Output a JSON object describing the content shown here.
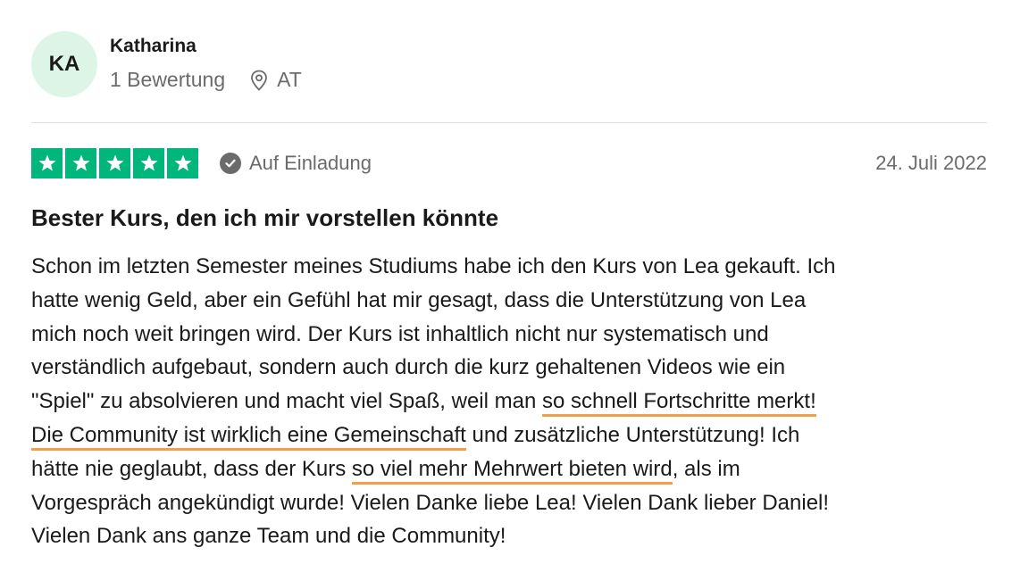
{
  "reviewer": {
    "initials": "KA",
    "name": "Katharina",
    "review_count": "1 Bewertung",
    "country": "AT"
  },
  "review": {
    "rating": 5,
    "stars_color": "#00b67a",
    "invited_label": "Auf Einladung",
    "date": "24. Juli 2022",
    "title": "Bester Kurs, den ich mir vorstellen könnte",
    "highlight_color": "#f0a04b",
    "body": {
      "l1": "Schon im letzten Semester meines Studiums habe ich den Kurs von Lea gekauft. Ich",
      "l2": "hatte wenig Geld, aber ein Gefühl hat mir gesagt, dass die Unterstützung von Lea",
      "l3": "mich noch weit bringen wird. Der Kurs ist inhaltlich nicht nur systematisch und",
      "l4": "verständlich aufgebaut, sondern auch durch die kurz gehaltenen Videos wie ein",
      "l5_a": "\"Spiel\" zu absolvieren und macht viel Spaß, weil man ",
      "l5_hl": "so schnell Fortschritte merkt!",
      "l6_hl": "Die Community ist wirklich eine Gemeinschaft",
      "l6_b": " und zusätzliche Unterstützung! Ich",
      "l7_a": "hätte nie geglaubt, dass der Kurs ",
      "l7_hl": "so viel mehr Mehrwert bieten wird",
      "l7_b": ", als im",
      "l8": "Vorgespräch angekündigt wurde! Vielen Danke liebe Lea! Vielen Dank lieber Daniel!",
      "l9": "Vielen Dank ans ganze Team und die Community!"
    }
  },
  "icons": {
    "location": "location-pin-icon",
    "verified": "check-circle-icon",
    "star": "star-icon"
  }
}
